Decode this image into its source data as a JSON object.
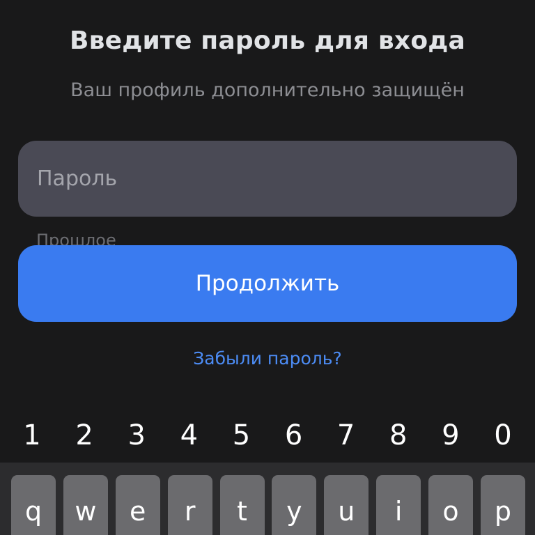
{
  "header": {
    "title": "Введите пароль для входа",
    "subtitle": "Ваш профиль дополнительно защищён"
  },
  "password": {
    "placeholder": "Пароль",
    "value": "",
    "hint": "Прошлое"
  },
  "actions": {
    "continue_label": "Продолжить",
    "forgot_label": "Забыли пароль?"
  },
  "keyboard": {
    "numbers": [
      "1",
      "2",
      "3",
      "4",
      "5",
      "6",
      "7",
      "8",
      "9",
      "0"
    ],
    "letters": [
      "q",
      "w",
      "e",
      "r",
      "t",
      "y",
      "u",
      "i",
      "o",
      "p"
    ]
  },
  "colors": {
    "background": "#19191a",
    "field": "#4a4a55",
    "accent": "#3a7bf0",
    "link": "#4c8cf5"
  }
}
